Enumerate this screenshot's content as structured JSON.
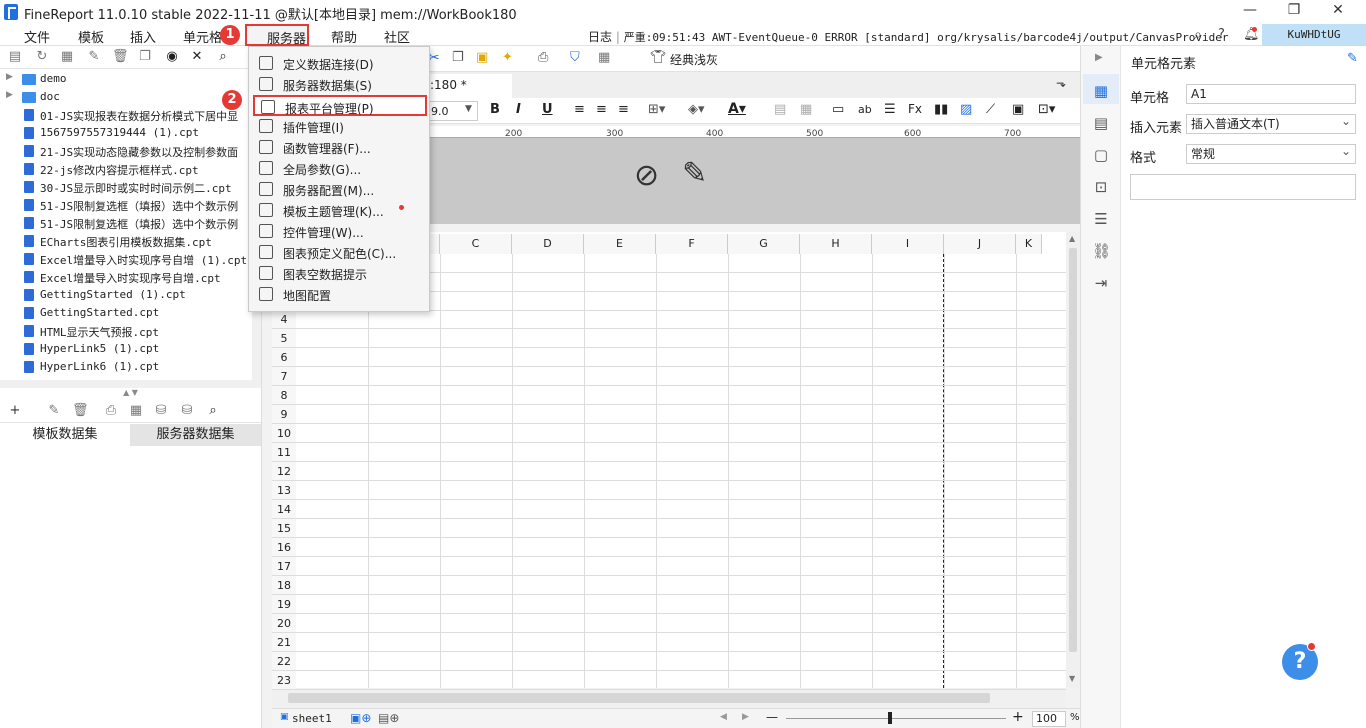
{
  "window": {
    "title": "FineReport 11.0.10 stable 2022-11-11 @默认[本地目录]    mem://WorkBook180"
  },
  "menubar": {
    "items": [
      "文件",
      "模板",
      "插入",
      "单元格",
      "服务器",
      "帮助",
      "社区"
    ],
    "log_label": "日志",
    "log_message": "严重:09:51:43 AWT-EventQueue-0 ERROR [standard] org/krysalis/barcode4j/output/CanvasProvider",
    "user": "KuWHDtUG",
    "badge1": "1",
    "badge2": "2"
  },
  "toolbar": {
    "theme_label": "经典浅灰",
    "tab_title": ":180 *",
    "font_size": "9.0"
  },
  "tree": {
    "items": [
      {
        "type": "folder",
        "label": "demo"
      },
      {
        "type": "folder",
        "label": "doc"
      },
      {
        "type": "file",
        "label": "01-JS实现报表在数据分析模式下居中显"
      },
      {
        "type": "file",
        "label": "1567597557319444 (1).cpt"
      },
      {
        "type": "file",
        "label": "21-JS实现动态隐藏参数以及控制参数面"
      },
      {
        "type": "file",
        "label": "22-js修改内容提示框样式.cpt"
      },
      {
        "type": "file",
        "label": "30-JS显示即时或实时时间示例二.cpt"
      },
      {
        "type": "file",
        "label": "51-JS限制复选框（填报）选中个数示例"
      },
      {
        "type": "file",
        "label": "51-JS限制复选框（填报）选中个数示例"
      },
      {
        "type": "file",
        "label": "ECharts图表引用模板数据集.cpt"
      },
      {
        "type": "file",
        "label": "Excel增量导入时实现序号自增 (1).cpt"
      },
      {
        "type": "file",
        "label": "Excel增量导入时实现序号自增.cpt"
      },
      {
        "type": "file",
        "label": "GettingStarted (1).cpt"
      },
      {
        "type": "file",
        "label": "GettingStarted.cpt"
      },
      {
        "type": "file",
        "label": "HTML显示天气预报.cpt"
      },
      {
        "type": "file",
        "label": "HyperLink5 (1).cpt"
      },
      {
        "type": "file",
        "label": "HyperLink6 (1).cpt"
      }
    ]
  },
  "dataset_tabs": {
    "template": "模板数据集",
    "server": "服务器数据集"
  },
  "dropdown": {
    "items": [
      "定义数据连接(D)",
      "服务器数据集(S)",
      "报表平台管理(P)",
      "插件管理(I)",
      "函数管理器(F)...",
      "全局参数(G)...",
      "服务器配置(M)...",
      "模板主题管理(K)...",
      "控件管理(W)...",
      "图表预定义配色(C)...",
      "图表空数据提示",
      "地图配置"
    ]
  },
  "ruler": {
    "ticks": [
      "200",
      "300",
      "400",
      "500",
      "600",
      "700"
    ]
  },
  "grid": {
    "columns": [
      "C",
      "D",
      "E",
      "F",
      "G",
      "H",
      "I",
      "J",
      "K"
    ],
    "rows": [
      "4",
      "5",
      "6",
      "7",
      "8",
      "9",
      "10",
      "11",
      "12",
      "13",
      "14",
      "15",
      "16",
      "17",
      "18",
      "19",
      "20",
      "21",
      "22",
      "23"
    ]
  },
  "footer": {
    "sheet": "sheet1",
    "zoom_minus": "—",
    "zoom_plus": "+",
    "zoom": "100",
    "percent": "%"
  },
  "rightpanel": {
    "title": "单元格元素",
    "cell_label": "单元格",
    "cell_value": "A1",
    "insert_label": "插入元素",
    "insert_value": "插入普通文本(T)",
    "format_label": "格式",
    "format_value": "常规"
  },
  "help": {
    "label": "?"
  },
  "colors": {
    "accent": "#1f6fe0",
    "highlight": "#e53935",
    "user_bg": "#bfe0f7"
  }
}
